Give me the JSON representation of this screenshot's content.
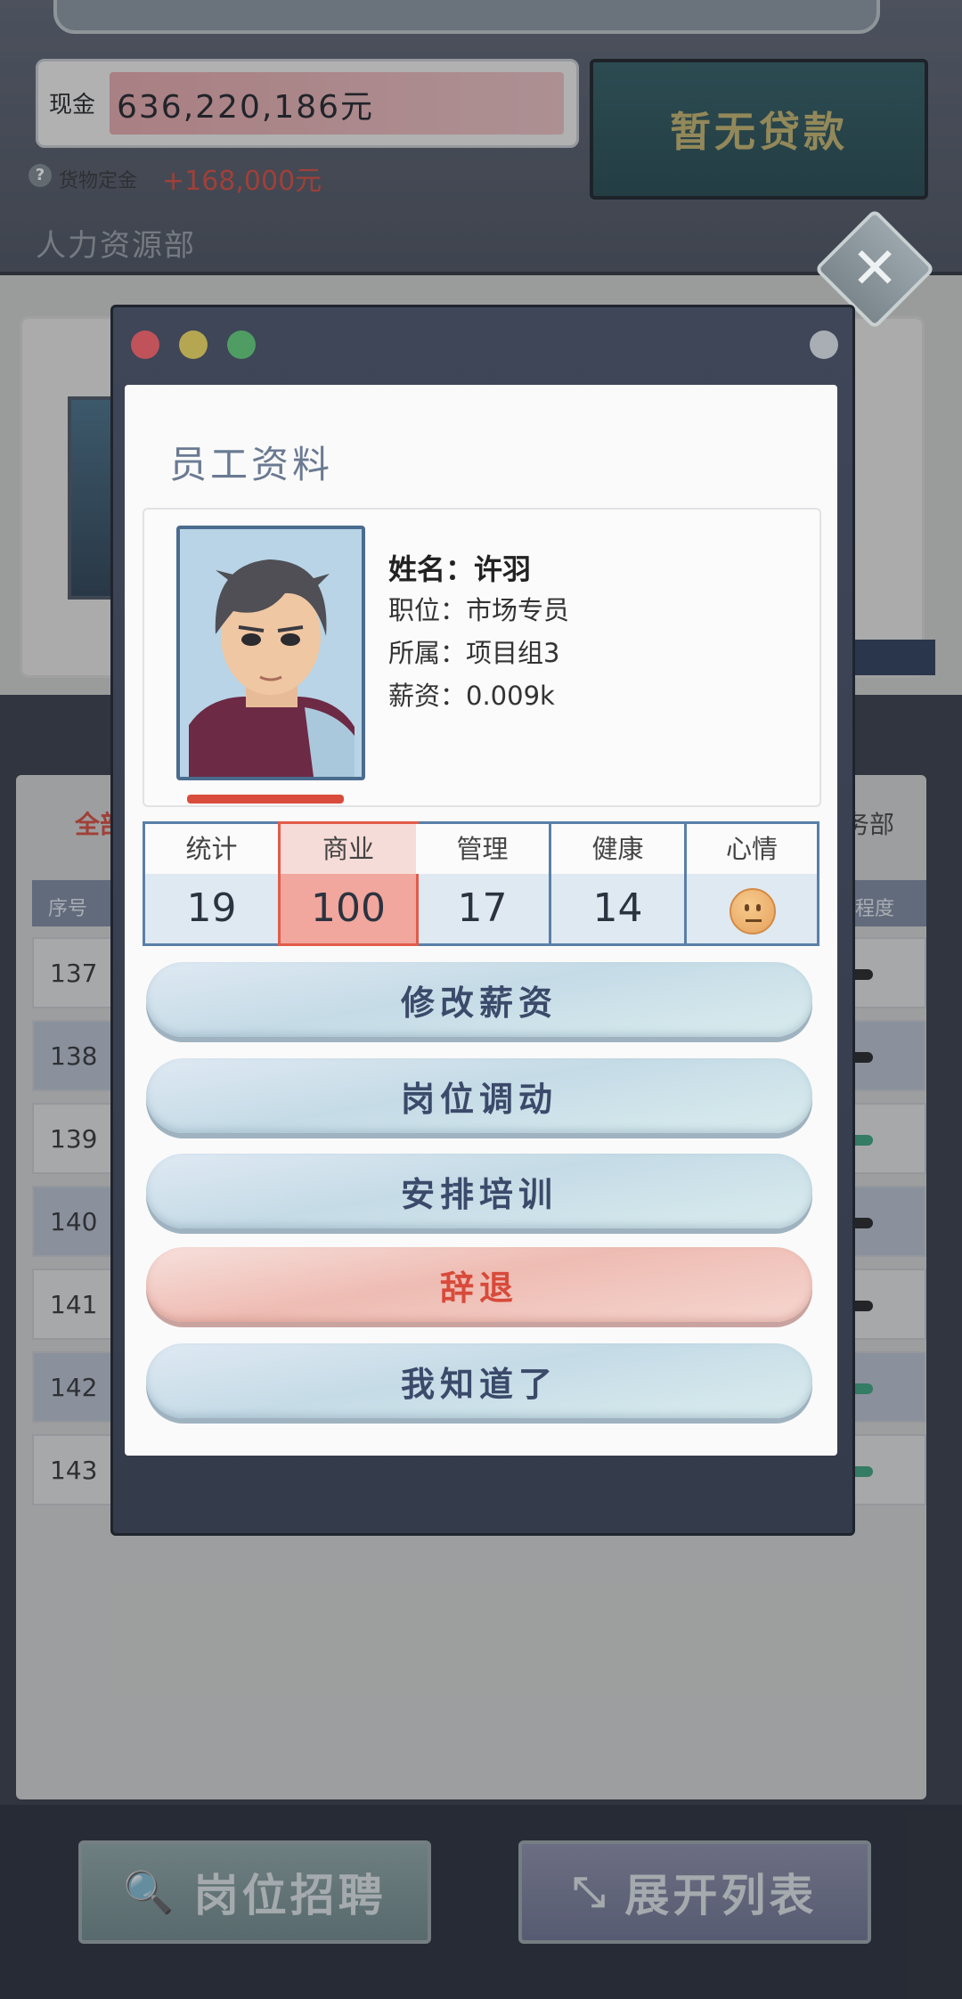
{
  "header": {
    "cash_label": "现金",
    "cash_value": "636,220,186元",
    "loan_button": "暂无贷款",
    "deposit_label": "货物定金",
    "deposit_value": "+168,000元",
    "department_title": "人力资源部"
  },
  "list": {
    "tab_all": "全部",
    "tab_right": "务部",
    "col_index": "序号",
    "col_right": "程度",
    "rows": [
      {
        "num": "137",
        "status": "dark"
      },
      {
        "num": "138",
        "status": "dark"
      },
      {
        "num": "139",
        "status": "green"
      },
      {
        "num": "140",
        "status": "dark"
      },
      {
        "num": "141",
        "status": "dark"
      },
      {
        "num": "142",
        "status": "green"
      },
      {
        "num": "143",
        "status": "green"
      }
    ]
  },
  "bottom": {
    "recruit_label": "岗位招聘",
    "expand_label": "展开列表"
  },
  "modal": {
    "title": "员工资料",
    "name_line": "姓名：许羽",
    "position_line": "职位：市场专员",
    "group_line": "所属：项目组3",
    "salary_line": "薪资：0.009k",
    "stats": [
      {
        "label": "统计",
        "value": "19"
      },
      {
        "label": "商业",
        "value": "100",
        "highlight": true
      },
      {
        "label": "管理",
        "value": "17"
      },
      {
        "label": "健康",
        "value": "14"
      },
      {
        "label": "心情",
        "value": "",
        "icon": "neutral-face-icon"
      }
    ],
    "buttons": {
      "change_salary": "修改薪资",
      "transfer": "岗位调动",
      "training": "安排培训",
      "dismiss": "辞退",
      "acknowledge": "我知道了"
    }
  },
  "colors": {
    "accent_red": "#d84a3a",
    "stat_border": "#5a7fa8",
    "modal_frame": "#3e4658"
  }
}
